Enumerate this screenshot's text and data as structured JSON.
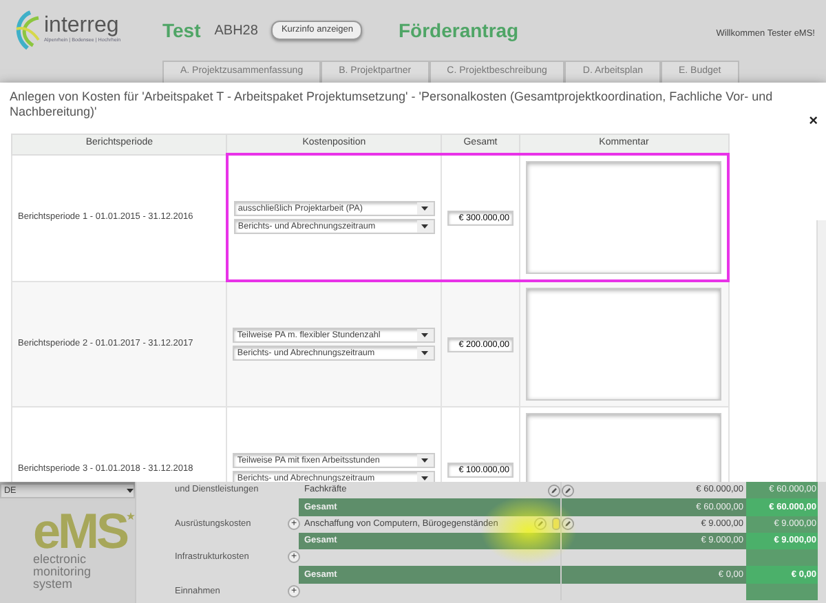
{
  "header": {
    "logo_text": "interreg",
    "logo_subtitle": "Alpenrhein | Bodensee | Hochrhein",
    "project": "Test",
    "code": "ABH28",
    "info_button": "Kurzinfo anzeigen",
    "section": "Förderantrag",
    "welcome": "Willkommen Tester eMS!"
  },
  "tabs": [
    {
      "label": "A. Projektzusammenfassung",
      "selected": false
    },
    {
      "label": "B. Projektpartner",
      "selected": false
    },
    {
      "label": "C. Projektbeschreibung",
      "selected": false
    },
    {
      "label": "D. Arbeitsplan",
      "selected": false
    },
    {
      "label": "E. Budget",
      "selected": false
    }
  ],
  "modal": {
    "title": "Anlegen von Kosten für 'Arbeitspaket T - Arbeitspaket Projektumsetzung' - 'Personalkosten (Gesamtprojektkoordination, Fachliche Vor- und Nachbereitung)'",
    "close": "×",
    "columns": [
      "Berichtsperiode",
      "Kostenposition",
      "Gesamt",
      "Kommentar"
    ],
    "rows": [
      {
        "period": "Berichtsperiode 1 - 01.01.2015 - 31.12.2016",
        "position": "ausschließlich Projektarbeit (PA)",
        "timeframe": "Berichts- und Abrechnungszeitraum",
        "amount": "€ 300.000,00",
        "highlighted": true
      },
      {
        "period": "Berichtsperiode 2 - 01.01.2017 - 31.12.2017",
        "position": "Teilweise PA m. flexibler Stundenzahl",
        "timeframe": "Berichts- und Abrechnungszeitraum",
        "amount": "€ 200.000,00",
        "highlighted": false
      },
      {
        "period": "Berichtsperiode 3 - 01.01.2018 - 31.12.2018",
        "position": "Teilweise PA mit fixen Arbeitsstunden",
        "timeframe": "Berichts- und Abrechnungszeitraum",
        "amount": "€ 100.000,00",
        "highlighted": false
      }
    ]
  },
  "sidebar": {
    "language": "DE",
    "logo_text": "eMS",
    "logo_caption": [
      "electronic",
      "monitoring",
      "system"
    ]
  },
  "costs": [
    {
      "kind": "item",
      "category": "und Dienstleistungen",
      "description": "Fachkräfte",
      "amount": "€ 60.000,00",
      "total": "€ 60.000,00"
    },
    {
      "kind": "total",
      "label": "Gesamt",
      "amount": "€ 60.000,00",
      "total": "€ 60.000,00"
    },
    {
      "kind": "item",
      "category": "Ausrüstungskosten",
      "add": "+",
      "description": "Anschaffung von Computern, Bürogegenständen",
      "amount": "€ 9.000,00",
      "total": "€ 9.000,00"
    },
    {
      "kind": "total",
      "label": "Gesamt",
      "amount": "€ 9.000,00",
      "total": "€ 9.000,00"
    },
    {
      "kind": "item",
      "category": "Infrastrukturkosten",
      "add": "+"
    },
    {
      "kind": "total",
      "label": "Gesamt",
      "amount": "€ 0,00",
      "total": "€ 0,00"
    },
    {
      "kind": "item",
      "category": "Einnahmen",
      "add": "+"
    }
  ]
}
